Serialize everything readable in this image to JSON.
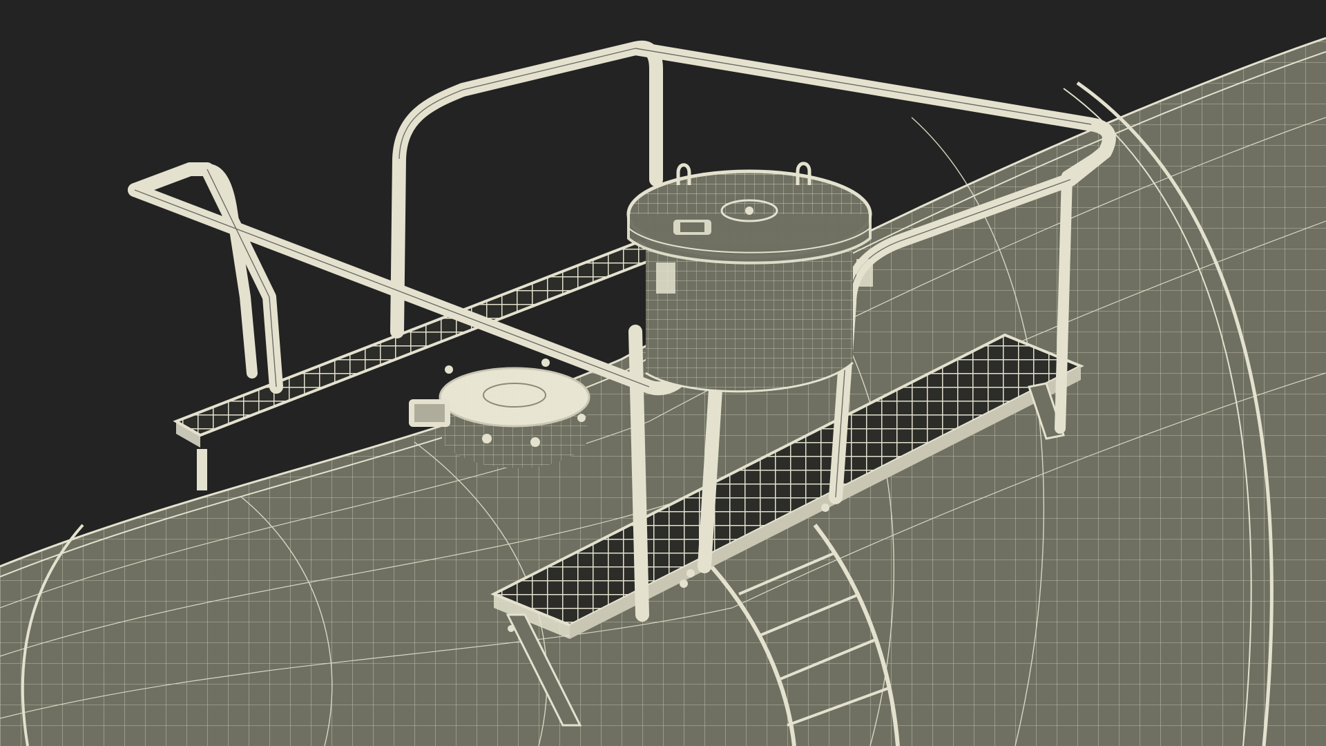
{
  "scene": {
    "subject": "tank-car-top-wireframe",
    "colors": {
      "background": "#232323",
      "surface": "#6f7061",
      "surface_dark": "#5d5e52",
      "wire": "#e4e2cf",
      "wire_dim": "#c9c7b4"
    }
  }
}
